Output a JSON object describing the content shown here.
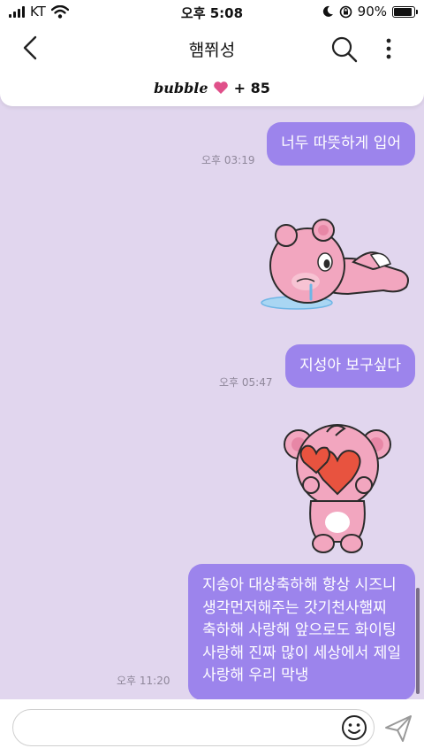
{
  "status_bar": {
    "carrier": "KT",
    "time": "오후 5:08",
    "battery": "90%",
    "battery_level": 0.9
  },
  "header": {
    "title": "햄쮜성"
  },
  "bubble_card": {
    "word": "bubble",
    "count": "+ 85"
  },
  "messages": [
    {
      "text": "너두 따뜻하게 입어",
      "time": "오후 03:19"
    },
    {
      "text": "지성아 보구싶다",
      "time": "오후 05:47"
    },
    {
      "lines": [
        "지송아 대상축하해 항상 시즈니",
        "생각먼저해주는 갓기천사햄찌",
        "축하해 사랑해 앞으로도 화이팅",
        "사랑해 진짜 많이 세상에서 제일",
        "사랑해 우리 막냉"
      ],
      "time": "오후 11:20"
    }
  ],
  "stickers": [
    {
      "name": "lying-pink-bear"
    },
    {
      "name": "heart-holding-bear"
    }
  ],
  "input": {
    "placeholder": ""
  },
  "colors": {
    "chat_background": "#e1d6ee",
    "bubble": "#9c84ec",
    "bear_pink": "#f2a6bf",
    "heart_red": "#e8533f"
  }
}
